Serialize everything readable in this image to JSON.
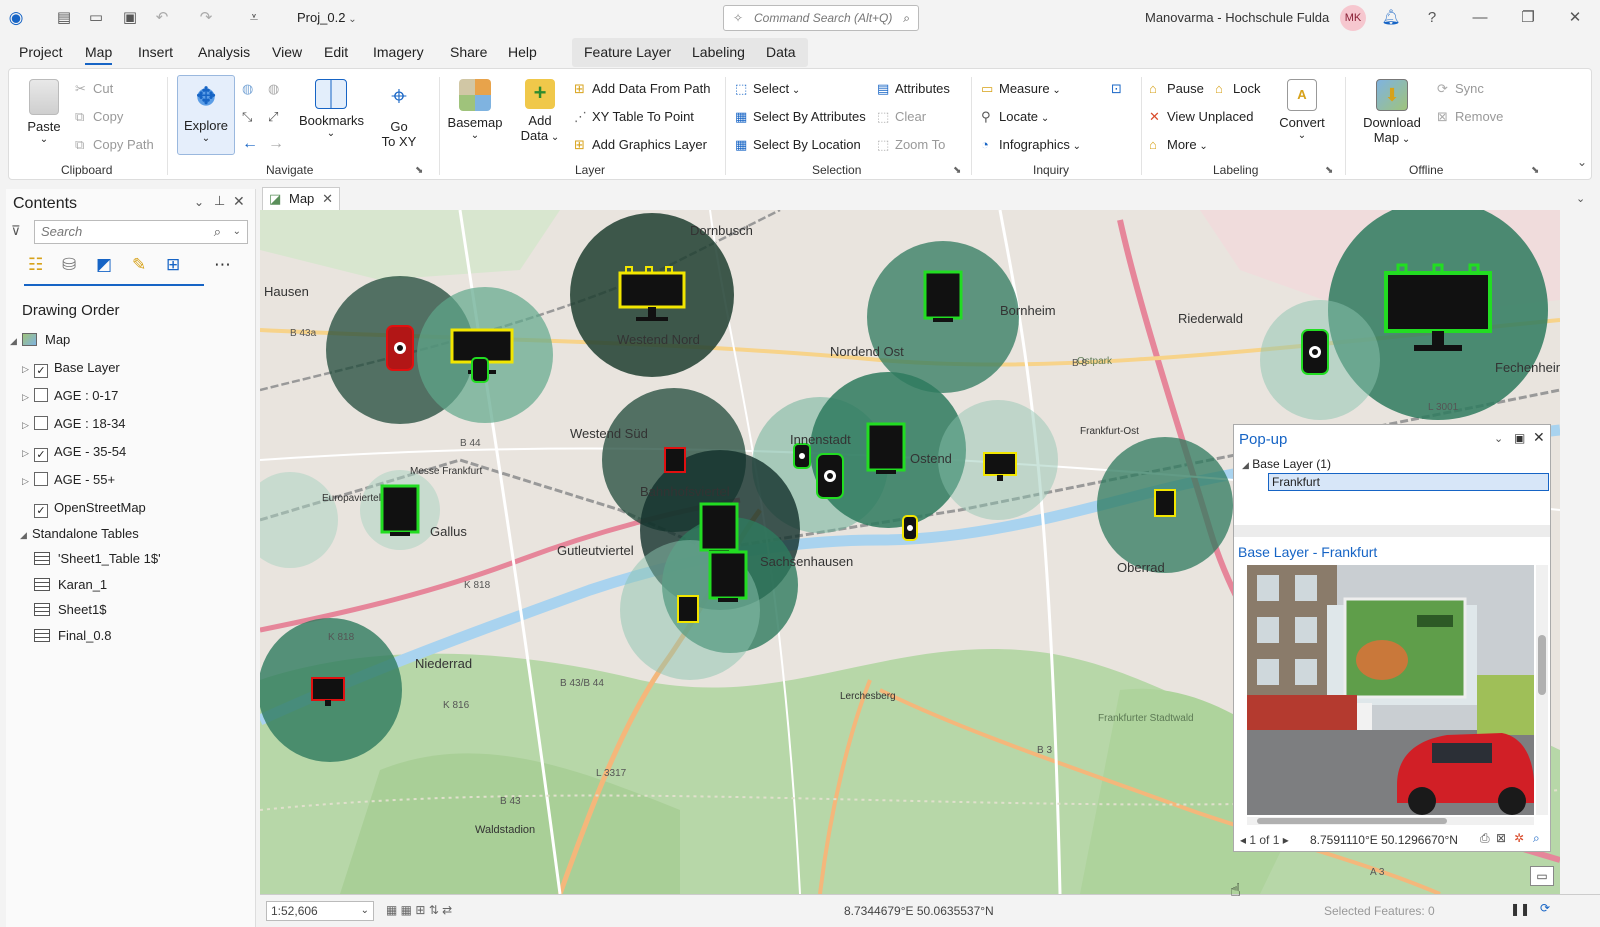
{
  "titlebar": {
    "project_name": "Proj_0.2",
    "command_search_placeholder": "Command Search (Alt+Q)",
    "user_name": "Manovarma - Hochschule Fulda",
    "user_initials": "MK"
  },
  "menubar": {
    "tabs": [
      "Project",
      "Map",
      "Insert",
      "Analysis",
      "View",
      "Edit",
      "Imagery",
      "Share",
      "Help"
    ],
    "active_tab": "Map",
    "contextual_tabs": [
      "Feature Layer",
      "Labeling",
      "Data"
    ]
  },
  "ribbon": {
    "clipboard": {
      "label": "Clipboard",
      "paste": "Paste",
      "cut": "Cut",
      "copy": "Copy",
      "copy_path": "Copy Path"
    },
    "navigate": {
      "label": "Navigate",
      "explore": "Explore",
      "bookmarks": "Bookmarks",
      "go_to_xy_line1": "Go",
      "go_to_xy_line2": "To XY"
    },
    "layer": {
      "label": "Layer",
      "basemap": "Basemap",
      "add_data_line1": "Add",
      "add_data_line2": "Data",
      "add_data_from_path": "Add Data From Path",
      "xy_table_to_point": "XY Table To Point",
      "add_graphics_layer": "Add Graphics Layer"
    },
    "selection": {
      "label": "Selection",
      "select": "Select",
      "select_by_attributes": "Select By Attributes",
      "select_by_location": "Select By Location",
      "attributes": "Attributes",
      "clear": "Clear",
      "zoom_to": "Zoom To"
    },
    "inquiry": {
      "label": "Inquiry",
      "measure": "Measure",
      "locate": "Locate",
      "infographics": "Infographics"
    },
    "labeling": {
      "label": "Labeling",
      "pause": "Pause",
      "lock": "Lock",
      "view_unplaced": "View Unplaced",
      "more": "More",
      "convert": "Convert"
    },
    "offline": {
      "label": "Offline",
      "download_map_line1": "Download",
      "download_map_line2": "Map",
      "sync": "Sync",
      "remove": "Remove"
    }
  },
  "contents": {
    "title": "Contents",
    "search_placeholder": "Search",
    "drawing_order_label": "Drawing Order",
    "map_label": "Map",
    "layers": [
      {
        "name": "Base Layer",
        "checked": true
      },
      {
        "name": "AGE : 0-17",
        "checked": false
      },
      {
        "name": "AGE : 18-34",
        "checked": false
      },
      {
        "name": "AGE - 35-54",
        "checked": true
      },
      {
        "name": "AGE - 55+",
        "checked": false
      },
      {
        "name": "OpenStreetMap",
        "checked": true
      }
    ],
    "standalone_label": "Standalone Tables",
    "tables": [
      "'Sheet1_Table 1$'",
      "Karan_1",
      "Sheet1$",
      "Final_0.8"
    ]
  },
  "map": {
    "tab_label": "Map",
    "place_labels": [
      "Dornbusch",
      "Hausen",
      "Westend Nord",
      "Nordend Ost",
      "Bornheim",
      "Riederwald",
      "Fechenheim",
      "Westend Süd",
      "Innenstadt",
      "Ostend",
      "Bahnhofsviertel",
      "Gallus",
      "Gutleutviertel",
      "Sachsenhausen",
      "Oberrad",
      "Niederrad",
      "Waldstadion",
      "Lerchesberg",
      "Frankfurter Stadtwald",
      "Ostpark",
      "Frankfurt-Ost",
      "Europaviertel",
      "Messe Frankfurt"
    ],
    "road_labels": [
      "B 8",
      "B 44",
      "K 818",
      "K 816",
      "B 43",
      "L 3317",
      "B 3",
      "A 3",
      "B 43a",
      "L 3001",
      "K 818",
      "B 43/B 44"
    ]
  },
  "popup": {
    "title": "Pop-up",
    "layer_group": "Base Layer (1)",
    "selected_feature": "Frankfurt",
    "detail_title": "Base Layer - Frankfurt",
    "page_indicator": "1 of 1",
    "coordinates": "8.7591110°E 50.1296670°N"
  },
  "statusbar": {
    "scale": "1:52,606",
    "coordinates": "8.7344679°E 50.0635537°N",
    "selected_features": "Selected Features: 0"
  },
  "colors": {
    "accent": "#1664c5",
    "circle_dark": "#1f4a3a",
    "circle_mid": "#2e7a5e",
    "circle_light": "#6fb39a",
    "billboard_yellow": "#f2e600",
    "billboard_green": "#22dd22",
    "billboard_red": "#e01010"
  }
}
